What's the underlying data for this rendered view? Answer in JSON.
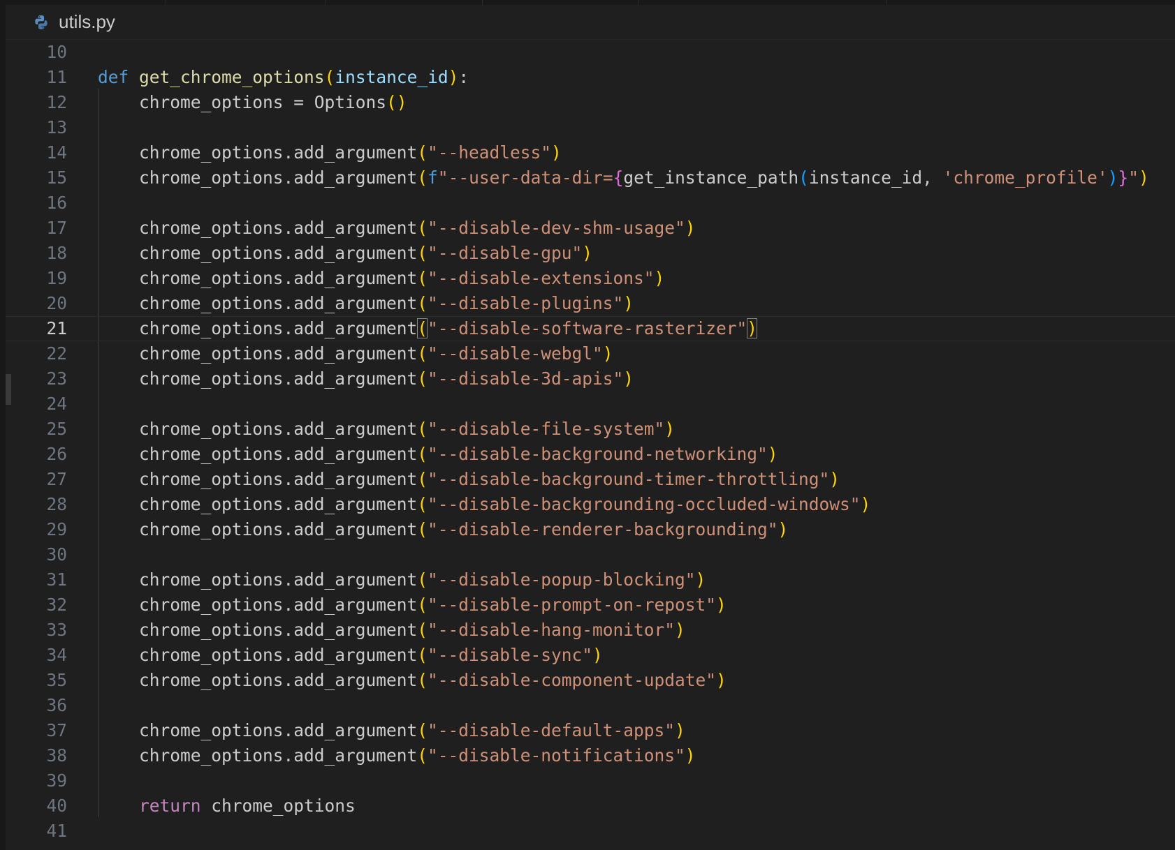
{
  "breadcrumb": {
    "file_name": "utils.py",
    "file_icon": "python-icon"
  },
  "editor": {
    "language": "python",
    "current_line": 21,
    "colors": {
      "background": "#1f1f1f",
      "keyword": "#569cd6",
      "return_keyword": "#c586c0",
      "function": "#dcdcaa",
      "parameter": "#9cdcfe",
      "string": "#ce9178",
      "bracket_level_1": "#ffd700",
      "bracket_level_2": "#da70d6",
      "bracket_level_3": "#179fff"
    },
    "lines": [
      {
        "n": "10",
        "code": ""
      },
      {
        "n": "11",
        "code": "def get_chrome_options(instance_id):"
      },
      {
        "n": "12",
        "code": "    chrome_options = Options()"
      },
      {
        "n": "13",
        "code": ""
      },
      {
        "n": "14",
        "code": "    chrome_options.add_argument(\"--headless\")"
      },
      {
        "n": "15",
        "code": "    chrome_options.add_argument(f\"--user-data-dir={get_instance_path(instance_id, 'chrome_profile')}\")"
      },
      {
        "n": "16",
        "code": ""
      },
      {
        "n": "17",
        "code": "    chrome_options.add_argument(\"--disable-dev-shm-usage\")"
      },
      {
        "n": "18",
        "code": "    chrome_options.add_argument(\"--disable-gpu\")"
      },
      {
        "n": "19",
        "code": "    chrome_options.add_argument(\"--disable-extensions\")"
      },
      {
        "n": "20",
        "code": "    chrome_options.add_argument(\"--disable-plugins\")"
      },
      {
        "n": "21",
        "code": "    chrome_options.add_argument(\"--disable-software-rasterizer\")"
      },
      {
        "n": "22",
        "code": "    chrome_options.add_argument(\"--disable-webgl\")"
      },
      {
        "n": "23",
        "code": "    chrome_options.add_argument(\"--disable-3d-apis\")"
      },
      {
        "n": "24",
        "code": ""
      },
      {
        "n": "25",
        "code": "    chrome_options.add_argument(\"--disable-file-system\")"
      },
      {
        "n": "26",
        "code": "    chrome_options.add_argument(\"--disable-background-networking\")"
      },
      {
        "n": "27",
        "code": "    chrome_options.add_argument(\"--disable-background-timer-throttling\")"
      },
      {
        "n": "28",
        "code": "    chrome_options.add_argument(\"--disable-backgrounding-occluded-windows\")"
      },
      {
        "n": "29",
        "code": "    chrome_options.add_argument(\"--disable-renderer-backgrounding\")"
      },
      {
        "n": "30",
        "code": ""
      },
      {
        "n": "31",
        "code": "    chrome_options.add_argument(\"--disable-popup-blocking\")"
      },
      {
        "n": "32",
        "code": "    chrome_options.add_argument(\"--disable-prompt-on-repost\")"
      },
      {
        "n": "33",
        "code": "    chrome_options.add_argument(\"--disable-hang-monitor\")"
      },
      {
        "n": "34",
        "code": "    chrome_options.add_argument(\"--disable-sync\")"
      },
      {
        "n": "35",
        "code": "    chrome_options.add_argument(\"--disable-component-update\")"
      },
      {
        "n": "36",
        "code": ""
      },
      {
        "n": "37",
        "code": "    chrome_options.add_argument(\"--disable-default-apps\")"
      },
      {
        "n": "38",
        "code": "    chrome_options.add_argument(\"--disable-notifications\")"
      },
      {
        "n": "39",
        "code": ""
      },
      {
        "n": "40",
        "code": "    return chrome_options"
      },
      {
        "n": "41",
        "code": ""
      }
    ]
  }
}
